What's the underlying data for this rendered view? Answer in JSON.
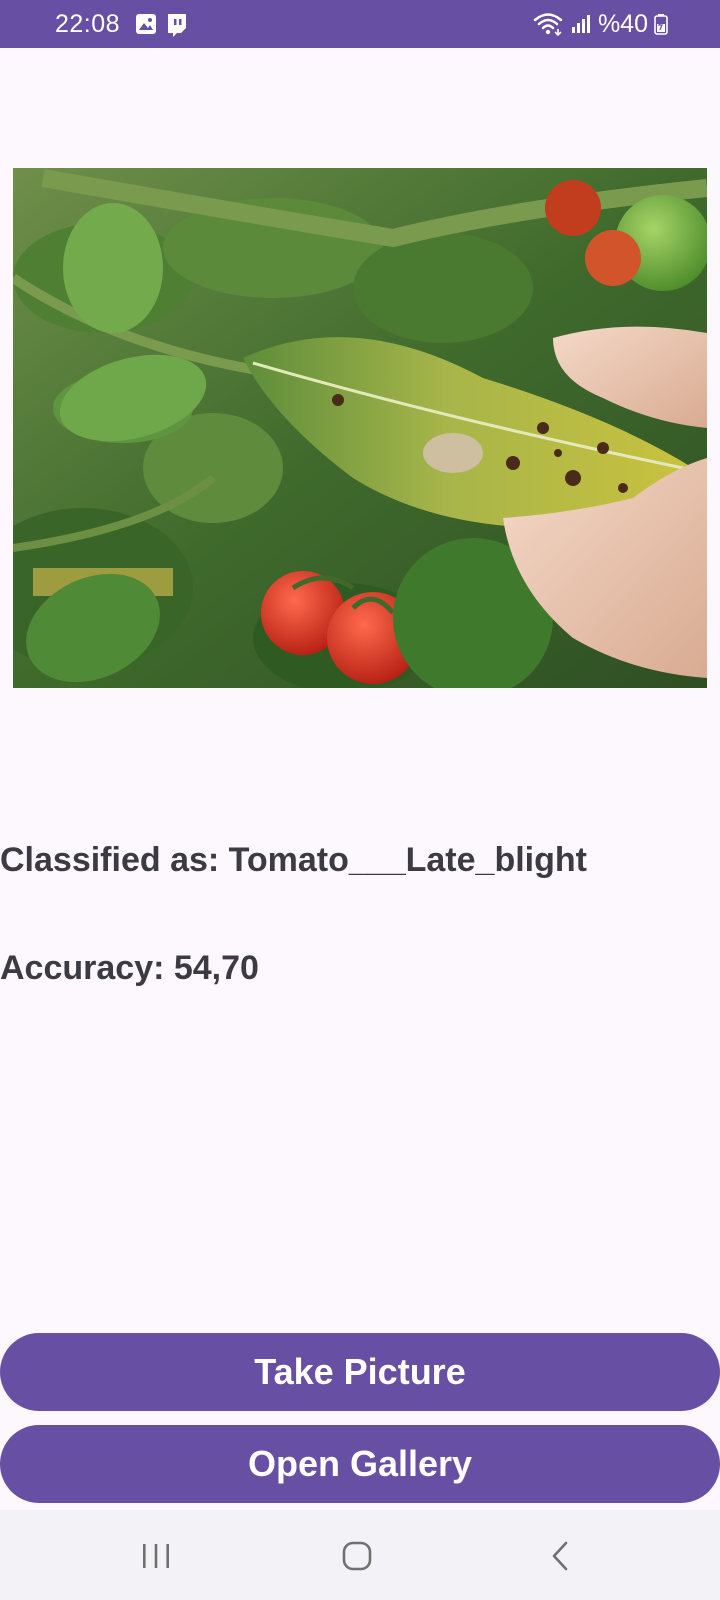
{
  "status_bar": {
    "time": "22:08",
    "left_icons": [
      "gallery-notification-icon",
      "twitch-notification-icon"
    ],
    "right_icons": [
      "wifi-icon",
      "signal-icon",
      "battery-icon"
    ],
    "battery": "%40"
  },
  "photo": {
    "subject": "tomato-leaf-photo"
  },
  "result": {
    "classified": "Classified as: Tomato___Late_blight",
    "accuracy": "Accuracy: 54,70"
  },
  "buttons": {
    "take_picture": "Take Picture",
    "open_gallery": "Open Gallery"
  },
  "colors": {
    "primary": "#6750a4",
    "background": "#fdf7fe",
    "text": "#3c3a42"
  },
  "nav_bar": {
    "items": [
      "recent-apps-icon",
      "home-icon",
      "back-icon"
    ]
  }
}
